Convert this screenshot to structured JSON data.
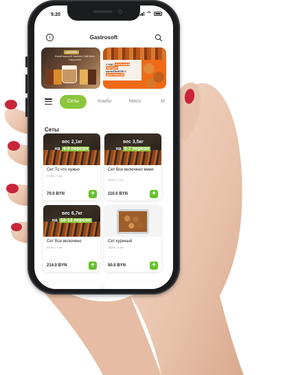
{
  "status_bar": {
    "time": "5:20"
  },
  "header": {
    "title": "Gastrosoft"
  },
  "banners": {
    "coffee": {
      "brand": "LACOSTA",
      "text": "Новый вкусный Заказать Café Mario Cappuccino"
    },
    "shashlik": {
      "line1": "У НАС",
      "highlight1": "БОЛЬШИЕ ПОРЦИИ",
      "line2": "ШАШЛЫКОВ С",
      "highlight2": "ДОСТАВКОЙ"
    }
  },
  "categories": {
    "active": "Сеты",
    "items": [
      "Комбо",
      "Мясо",
      "М"
    ]
  },
  "section": {
    "title": "Сеты"
  },
  "products": [
    {
      "weight_line": "вес 2,1кг",
      "persons_prefix": "на",
      "persons": "4-5 персон",
      "name": "Сет То что нужно",
      "meta": "2100г. | 1 шт.",
      "price": "70.0 BYN",
      "add": "+"
    },
    {
      "weight_line": "вес 3,5кг",
      "persons_prefix": "на",
      "persons": "5-7 персон",
      "name": "Сет Все включено мини",
      "meta": "3500г. | 1 шт.",
      "price": "110.0 BYN",
      "add": "+"
    },
    {
      "weight_line": "вес 6,7кг",
      "persons_prefix": "на",
      "persons": "10-13 персон",
      "name": "Сет Все включено",
      "meta": "6700г. | 1 шт.",
      "price": "214.0 BYN",
      "add": "+"
    },
    {
      "name": "Сет куриный",
      "meta": "1800г. | 1 шт.",
      "price": "50.0 BYN",
      "add": "+"
    }
  ],
  "colors": {
    "accent": "#8cc63f",
    "add_button": "#65c32e",
    "phone_body": "#1b1c1e",
    "promo_orange": "#f06a16"
  },
  "icons": [
    "info-icon",
    "search-icon",
    "menu-icon",
    "plus-icon"
  ]
}
